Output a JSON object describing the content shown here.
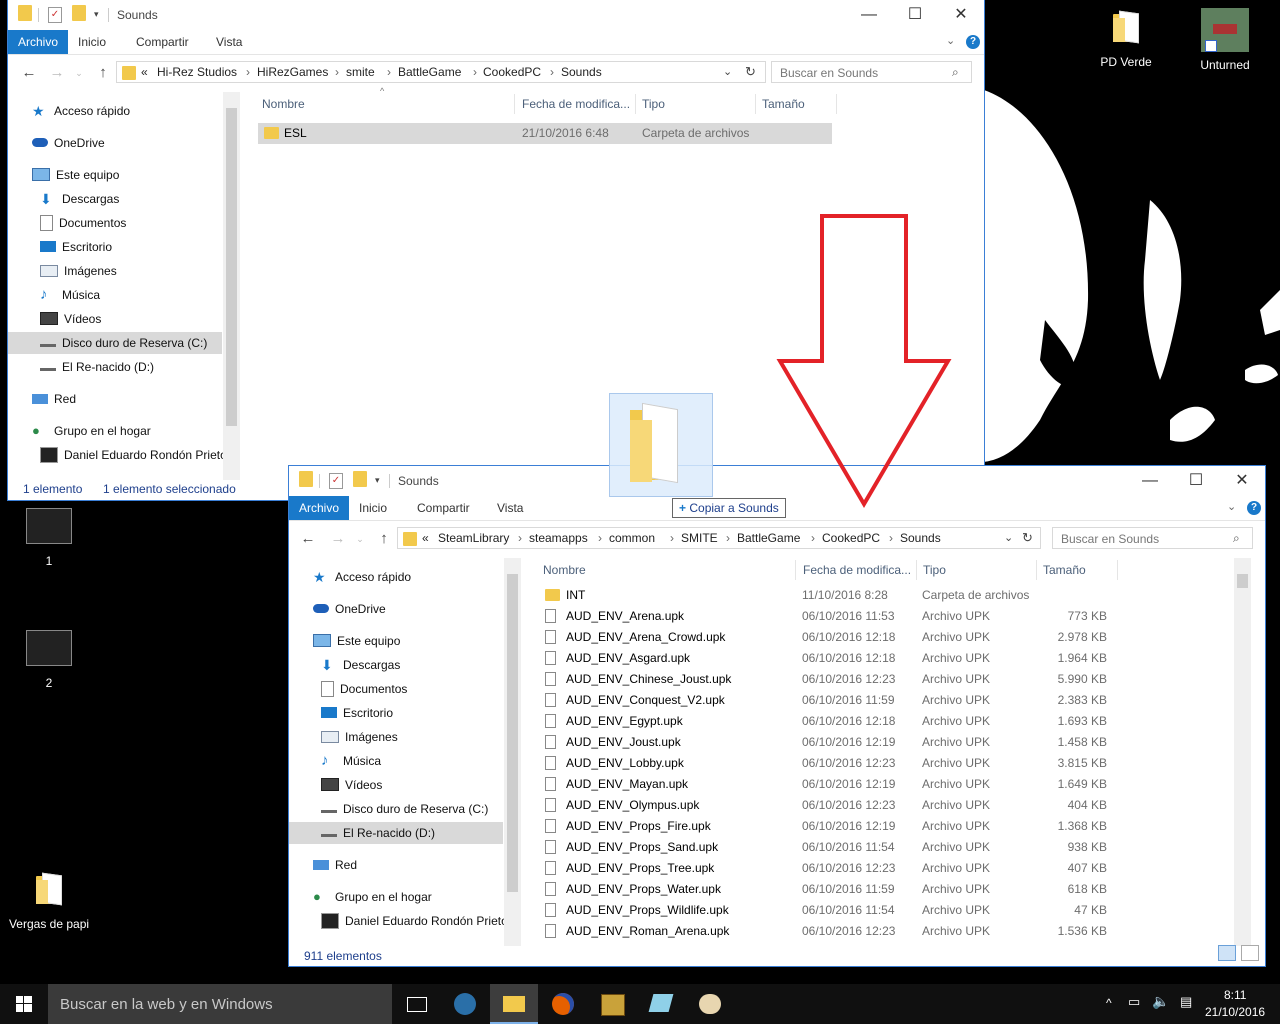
{
  "desktop": {
    "icons": [
      {
        "label": "PD Verde"
      },
      {
        "label": "Unturned"
      },
      {
        "label": "1"
      },
      {
        "label": "2"
      },
      {
        "label": "Vergas de papi"
      }
    ]
  },
  "window1": {
    "title": "Sounds",
    "ribbon_tabs": [
      "Archivo",
      "Inicio",
      "Compartir",
      "Vista"
    ],
    "breadcrumb": [
      "«",
      "Hi-Rez Studios",
      "HiRezGames",
      "smite",
      "BattleGame",
      "CookedPC",
      "Sounds"
    ],
    "search_placeholder": "Buscar en Sounds",
    "nav": [
      "Acceso rápido",
      "OneDrive",
      "Este equipo",
      "Descargas",
      "Documentos",
      "Escritorio",
      "Imágenes",
      "Música",
      "Vídeos",
      "Disco duro de Reserva (C:)",
      "El Re-nacido (D:)",
      "Red",
      "Grupo en el hogar",
      "Daniel Eduardo Rondón Prieto"
    ],
    "columns": [
      "Nombre",
      "Fecha de modifica...",
      "Tipo",
      "Tamaño"
    ],
    "rows": [
      {
        "name": "ESL",
        "date": "21/10/2016 6:48",
        "type": "Carpeta de archivos",
        "size": ""
      }
    ],
    "status_count": "1 elemento",
    "status_selected": "1 elemento seleccionado"
  },
  "drag": {
    "tooltip": "Copiar a Sounds"
  },
  "window2": {
    "title": "Sounds",
    "ribbon_tabs": [
      "Archivo",
      "Inicio",
      "Compartir",
      "Vista"
    ],
    "breadcrumb": [
      "«",
      "SteamLibrary",
      "steamapps",
      "common",
      "SMITE",
      "BattleGame",
      "CookedPC",
      "Sounds"
    ],
    "search_placeholder": "Buscar en Sounds",
    "nav": [
      "Acceso rápido",
      "OneDrive",
      "Este equipo",
      "Descargas",
      "Documentos",
      "Escritorio",
      "Imágenes",
      "Música",
      "Vídeos",
      "Disco duro de Reserva (C:)",
      "El Re-nacido (D:)",
      "Red",
      "Grupo en el hogar",
      "Daniel Eduardo Rondón Prieto"
    ],
    "columns": [
      "Nombre",
      "Fecha de modifica...",
      "Tipo",
      "Tamaño"
    ],
    "rows": [
      {
        "name": "INT",
        "date": "11/10/2016 8:28",
        "type": "Carpeta de archivos",
        "size": ""
      },
      {
        "name": "AUD_ENV_Arena.upk",
        "date": "06/10/2016 11:53",
        "type": "Archivo UPK",
        "size": "773 KB"
      },
      {
        "name": "AUD_ENV_Arena_Crowd.upk",
        "date": "06/10/2016 12:18",
        "type": "Archivo UPK",
        "size": "2.978 KB"
      },
      {
        "name": "AUD_ENV_Asgard.upk",
        "date": "06/10/2016 12:18",
        "type": "Archivo UPK",
        "size": "1.964 KB"
      },
      {
        "name": "AUD_ENV_Chinese_Joust.upk",
        "date": "06/10/2016 12:23",
        "type": "Archivo UPK",
        "size": "5.990 KB"
      },
      {
        "name": "AUD_ENV_Conquest_V2.upk",
        "date": "06/10/2016 11:59",
        "type": "Archivo UPK",
        "size": "2.383 KB"
      },
      {
        "name": "AUD_ENV_Egypt.upk",
        "date": "06/10/2016 12:18",
        "type": "Archivo UPK",
        "size": "1.693 KB"
      },
      {
        "name": "AUD_ENV_Joust.upk",
        "date": "06/10/2016 12:19",
        "type": "Archivo UPK",
        "size": "1.458 KB"
      },
      {
        "name": "AUD_ENV_Lobby.upk",
        "date": "06/10/2016 12:23",
        "type": "Archivo UPK",
        "size": "3.815 KB"
      },
      {
        "name": "AUD_ENV_Mayan.upk",
        "date": "06/10/2016 12:19",
        "type": "Archivo UPK",
        "size": "1.649 KB"
      },
      {
        "name": "AUD_ENV_Olympus.upk",
        "date": "06/10/2016 12:23",
        "type": "Archivo UPK",
        "size": "404 KB"
      },
      {
        "name": "AUD_ENV_Props_Fire.upk",
        "date": "06/10/2016 12:19",
        "type": "Archivo UPK",
        "size": "1.368 KB"
      },
      {
        "name": "AUD_ENV_Props_Sand.upk",
        "date": "06/10/2016 11:54",
        "type": "Archivo UPK",
        "size": "938 KB"
      },
      {
        "name": "AUD_ENV_Props_Tree.upk",
        "date": "06/10/2016 12:23",
        "type": "Archivo UPK",
        "size": "407 KB"
      },
      {
        "name": "AUD_ENV_Props_Water.upk",
        "date": "06/10/2016 11:59",
        "type": "Archivo UPK",
        "size": "618 KB"
      },
      {
        "name": "AUD_ENV_Props_Wildlife.upk",
        "date": "06/10/2016 11:54",
        "type": "Archivo UPK",
        "size": "47 KB"
      },
      {
        "name": "AUD_ENV_Roman_Arena.upk",
        "date": "06/10/2016 12:23",
        "type": "Archivo UPK",
        "size": "1.536 KB"
      }
    ],
    "status_count": "911 elementos"
  },
  "taskbar": {
    "search_placeholder": "Buscar en la web y en Windows",
    "time": "8:11",
    "date": "21/10/2016"
  },
  "colors": {
    "accent": "#1979ca",
    "arrow": "#e32228",
    "selection": "#d9d9d9"
  }
}
